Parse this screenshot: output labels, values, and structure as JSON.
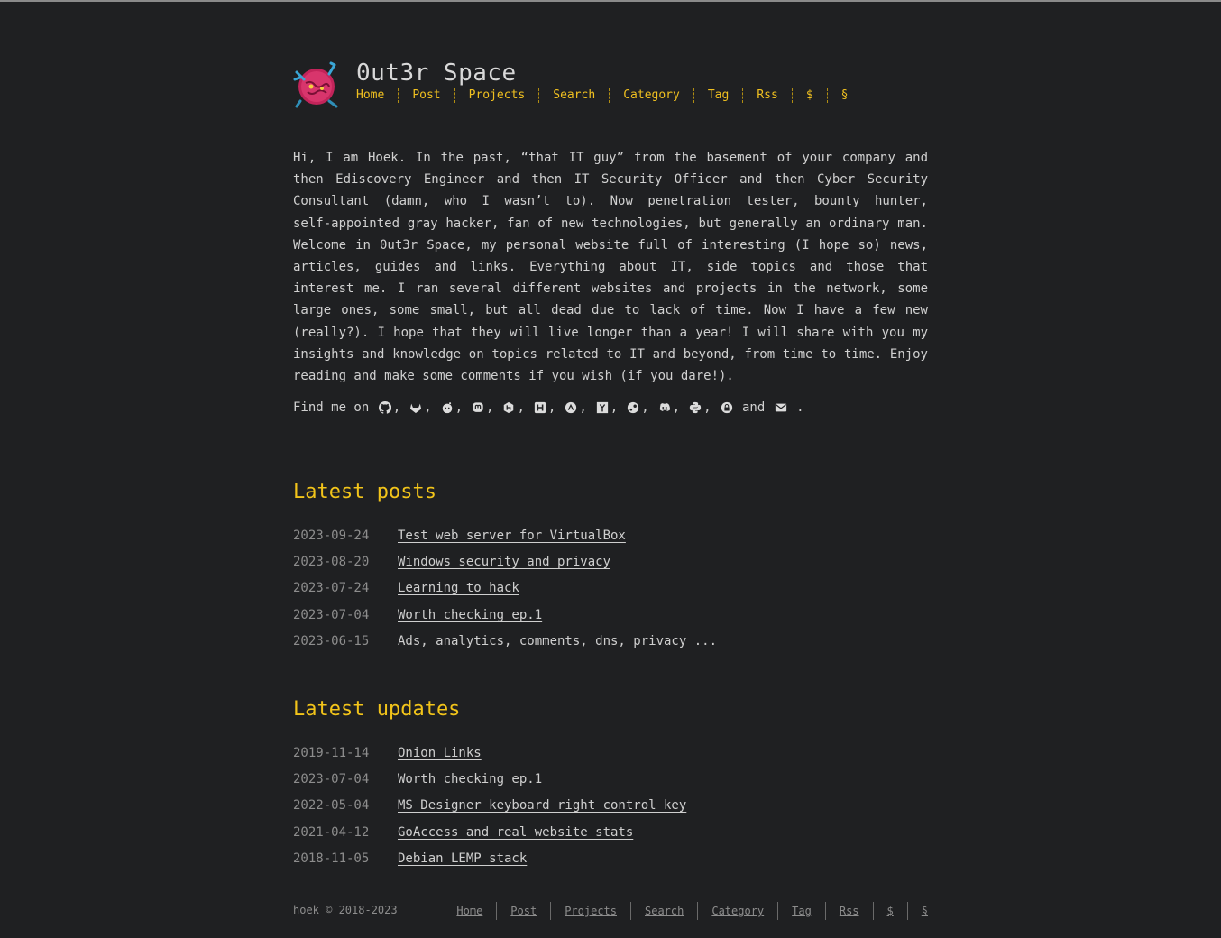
{
  "site": {
    "title": "0ut3r Space"
  },
  "nav": [
    "Home",
    "Post",
    "Projects",
    "Search",
    "Category",
    "Tag",
    "Rss",
    "$",
    "§"
  ],
  "intro": "Hi, I am Hoek. In the past, “that IT guy” from the basement of your company and then Ediscovery Engineer and then IT Security Officer and then Cyber Security Consultant (damn, who I wasn’t to). Now penetration tester, bounty hunter, self‑appointed gray hacker, fan of new technologies, but generally an ordinary man. Welcome in 0ut3r Space, my personal website full of interesting (I hope so) news, articles, guides and links. Everything about IT, side topics and those that interest me. I ran several different websites and projects in the network, some large ones, some small, but all dead due to lack of time. Now I have a few new (really?). I hope that they will live longer than a year! I will share with you my insights and knowledge on topics related to IT and beyond, from time to time. Enjoy reading and make some comments if you wish (if you dare!).",
  "findme": {
    "prefix": "Find me on",
    "and": "and",
    "end": ".",
    "icons": [
      "github-icon",
      "gitlab-icon",
      "reddit-icon",
      "mastodon-icon",
      "hackerone-icon",
      "hackthebox-icon",
      "tryhackme-icon",
      "ycombinator-icon",
      "steam-icon",
      "discord-icon",
      "python-icon",
      "lock-icon"
    ],
    "last_icon": "envelope-icon"
  },
  "latest_posts": {
    "heading": "Latest posts",
    "items": [
      {
        "date": "2023-09-24",
        "title": "Test web server for VirtualBox"
      },
      {
        "date": "2023-08-20",
        "title": "Windows security and privacy"
      },
      {
        "date": "2023-07-24",
        "title": "Learning to hack"
      },
      {
        "date": "2023-07-04",
        "title": "Worth checking ep.1"
      },
      {
        "date": "2023-06-15",
        "title": "Ads, analytics, comments, dns, privacy ..."
      }
    ]
  },
  "latest_updates": {
    "heading": "Latest updates",
    "items": [
      {
        "date": "2019-11-14",
        "title": "Onion Links"
      },
      {
        "date": "2023-07-04",
        "title": "Worth checking ep.1"
      },
      {
        "date": "2022-05-04",
        "title": "MS Designer keyboard right control key"
      },
      {
        "date": "2021-04-12",
        "title": "GoAccess and real website stats"
      },
      {
        "date": "2018-11-05",
        "title": "Debian LEMP stack"
      }
    ]
  },
  "footer": {
    "copyright": "hoek © 2018-2023",
    "nav": [
      "Home",
      "Post",
      "Projects",
      "Search",
      "Category",
      "Tag",
      "Rss",
      "$",
      "§"
    ]
  },
  "colors": {
    "background": "#1f2022",
    "accent": "#f2c41a",
    "text": "#d0d0d0",
    "muted": "#8d8d8d"
  }
}
